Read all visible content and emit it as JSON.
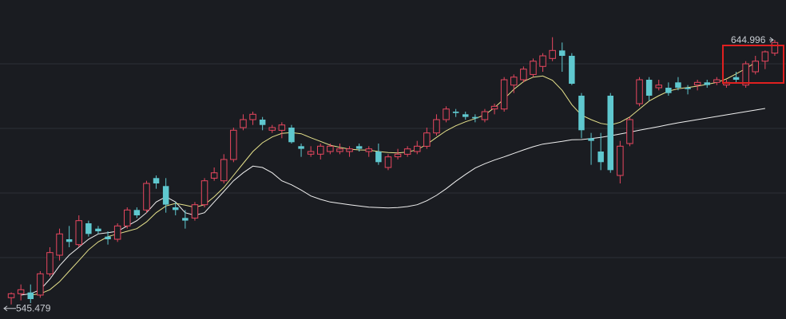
{
  "theme": {
    "background": "#1a1c21",
    "grid": "#2c2f36",
    "up_color": "#e8475f",
    "down_color": "#5fc8cf",
    "highlight_box": "#e02020",
    "label_color": "#c8ccd2"
  },
  "labels": {
    "max_price": "644.996",
    "min_price": "545.479"
  },
  "chart_data": {
    "type": "candlestick",
    "ylim": [
      540,
      660
    ],
    "grid": true,
    "candles": [
      {
        "o": 548,
        "h": 550,
        "l": 545.479,
        "c": 549.5
      },
      {
        "o": 549.5,
        "h": 553,
        "l": 547,
        "c": 551
      },
      {
        "o": 550,
        "h": 553,
        "l": 546,
        "c": 547.5
      },
      {
        "o": 549,
        "h": 558,
        "l": 548,
        "c": 557
      },
      {
        "o": 557,
        "h": 567,
        "l": 556,
        "c": 565
      },
      {
        "o": 564,
        "h": 574,
        "l": 562,
        "c": 572
      },
      {
        "o": 570,
        "h": 575,
        "l": 567,
        "c": 569
      },
      {
        "o": 568,
        "h": 579,
        "l": 567,
        "c": 577
      },
      {
        "o": 576,
        "h": 577,
        "l": 571,
        "c": 572
      },
      {
        "o": 574,
        "h": 575,
        "l": 572,
        "c": 573
      },
      {
        "o": 571,
        "h": 573,
        "l": 568,
        "c": 570
      },
      {
        "o": 570,
        "h": 576,
        "l": 569,
        "c": 575
      },
      {
        "o": 575,
        "h": 582,
        "l": 574,
        "c": 581
      },
      {
        "o": 581,
        "h": 582,
        "l": 578,
        "c": 579
      },
      {
        "o": 581,
        "h": 592,
        "l": 580,
        "c": 591
      },
      {
        "o": 593,
        "h": 594,
        "l": 589,
        "c": 591
      },
      {
        "o": 590,
        "h": 593,
        "l": 580,
        "c": 583
      },
      {
        "o": 582,
        "h": 584,
        "l": 579,
        "c": 581
      },
      {
        "o": 578,
        "h": 581,
        "l": 574,
        "c": 577
      },
      {
        "o": 578,
        "h": 584,
        "l": 577,
        "c": 583
      },
      {
        "o": 583,
        "h": 593,
        "l": 582,
        "c": 592
      },
      {
        "o": 593,
        "h": 597,
        "l": 592,
        "c": 595
      },
      {
        "o": 592,
        "h": 602,
        "l": 591,
        "c": 600
      },
      {
        "o": 600,
        "h": 612,
        "l": 599,
        "c": 611
      },
      {
        "o": 612,
        "h": 617,
        "l": 611,
        "c": 615
      },
      {
        "o": 615,
        "h": 618,
        "l": 613,
        "c": 617
      },
      {
        "o": 615,
        "h": 616,
        "l": 611,
        "c": 613
      },
      {
        "o": 611,
        "h": 613,
        "l": 610,
        "c": 612
      },
      {
        "o": 611,
        "h": 614,
        "l": 608,
        "c": 613
      },
      {
        "o": 612,
        "h": 613,
        "l": 606,
        "c": 606.5
      },
      {
        "o": 605,
        "h": 606,
        "l": 601,
        "c": 604
      },
      {
        "o": 602,
        "h": 605,
        "l": 601,
        "c": 603
      },
      {
        "o": 602,
        "h": 606,
        "l": 600,
        "c": 605
      },
      {
        "o": 603,
        "h": 606,
        "l": 602,
        "c": 605
      },
      {
        "o": 603,
        "h": 606,
        "l": 602,
        "c": 604
      },
      {
        "o": 603,
        "h": 605,
        "l": 601,
        "c": 604
      },
      {
        "o": 605,
        "h": 606,
        "l": 603,
        "c": 604
      },
      {
        "o": 603,
        "h": 605,
        "l": 601,
        "c": 604
      },
      {
        "o": 603,
        "h": 606,
        "l": 598,
        "c": 599
      },
      {
        "o": 597,
        "h": 602,
        "l": 596,
        "c": 601
      },
      {
        "o": 601,
        "h": 604,
        "l": 600,
        "c": 602
      },
      {
        "o": 602,
        "h": 605,
        "l": 601,
        "c": 604
      },
      {
        "o": 603,
        "h": 607,
        "l": 602,
        "c": 605
      },
      {
        "o": 605,
        "h": 612,
        "l": 604,
        "c": 610
      },
      {
        "o": 610,
        "h": 617,
        "l": 609,
        "c": 615
      },
      {
        "o": 615,
        "h": 620,
        "l": 614,
        "c": 619
      },
      {
        "o": 618,
        "h": 619,
        "l": 616,
        "c": 617.5
      },
      {
        "o": 617,
        "h": 618,
        "l": 615,
        "c": 616
      },
      {
        "o": 616,
        "h": 617,
        "l": 614,
        "c": 615.5
      },
      {
        "o": 615,
        "h": 619,
        "l": 614,
        "c": 618
      },
      {
        "o": 619,
        "h": 621,
        "l": 617,
        "c": 620
      },
      {
        "o": 619,
        "h": 631,
        "l": 618,
        "c": 630
      },
      {
        "o": 628,
        "h": 632,
        "l": 625,
        "c": 631
      },
      {
        "o": 630,
        "h": 635,
        "l": 629,
        "c": 634
      },
      {
        "o": 632,
        "h": 638,
        "l": 631,
        "c": 637
      },
      {
        "o": 635,
        "h": 640,
        "l": 633,
        "c": 639
      },
      {
        "o": 638,
        "h": 646,
        "l": 637,
        "c": 641
      },
      {
        "o": 641,
        "h": 644,
        "l": 633,
        "c": 639
      },
      {
        "o": 639,
        "h": 640,
        "l": 628,
        "c": 628.5
      },
      {
        "o": 624,
        "h": 625,
        "l": 608,
        "c": 611
      },
      {
        "o": 608,
        "h": 610,
        "l": 598,
        "c": 607
      },
      {
        "o": 603,
        "h": 610,
        "l": 596,
        "c": 599
      },
      {
        "o": 624,
        "h": 625,
        "l": 595,
        "c": 596
      },
      {
        "o": 594,
        "h": 607,
        "l": 591,
        "c": 605
      },
      {
        "o": 606,
        "h": 616,
        "l": 605,
        "c": 615
      },
      {
        "o": 621,
        "h": 631,
        "l": 620,
        "c": 630
      },
      {
        "o": 630,
        "h": 631,
        "l": 622,
        "c": 624
      },
      {
        "o": 627,
        "h": 630,
        "l": 626,
        "c": 628
      },
      {
        "o": 627,
        "h": 629,
        "l": 624,
        "c": 625
      },
      {
        "o": 629,
        "h": 631,
        "l": 626,
        "c": 627
      },
      {
        "o": 627,
        "h": 628,
        "l": 624.5,
        "c": 626.5
      },
      {
        "o": 628,
        "h": 630,
        "l": 626,
        "c": 629
      },
      {
        "o": 629,
        "h": 630,
        "l": 627,
        "c": 628
      },
      {
        "o": 629,
        "h": 631,
        "l": 628,
        "c": 630
      },
      {
        "o": 628,
        "h": 630,
        "l": 627,
        "c": 629
      },
      {
        "o": 631,
        "h": 633,
        "l": 629,
        "c": 630
      },
      {
        "o": 628,
        "h": 637,
        "l": 627,
        "c": 636
      },
      {
        "o": 633,
        "h": 639,
        "l": 632,
        "c": 637
      },
      {
        "o": 637,
        "h": 641,
        "l": 634,
        "c": 640.5
      },
      {
        "o": 640,
        "h": 644.996,
        "l": 639,
        "c": 644
      }
    ],
    "moving_averages": [
      {
        "color": "#f0f0f0",
        "values": [
          null,
          549,
          549.5,
          551,
          555,
          560,
          564,
          567,
          570,
          572,
          572.5,
          573,
          575,
          577,
          580,
          584,
          586,
          584,
          580,
          579,
          580,
          584,
          588,
          592,
          595,
          597.5,
          597,
          595,
          592,
          590.5,
          588.5,
          586.3,
          585,
          584,
          583.5,
          583,
          582.5,
          582.1,
          581.9,
          581.8,
          581.9,
          582.3,
          583,
          584.5,
          586.5,
          589,
          591.8,
          594.4,
          596.8,
          598.4,
          599.8,
          601,
          602.3,
          603.6,
          604.8,
          605.8,
          606.3,
          606.8,
          607.4,
          607.5,
          607.9,
          608.3,
          608.9,
          609.6,
          610.3,
          611,
          611.7,
          612.4,
          613.1,
          613.8,
          614.4,
          615,
          615.6,
          616.2,
          616.8,
          617.4,
          618,
          618.6,
          619.2
        ]
      },
      {
        "color": "#e6e28c",
        "values": [
          null,
          null,
          549,
          549.5,
          551,
          554,
          558,
          562,
          566,
          569,
          571,
          572,
          573,
          574,
          576.5,
          580,
          582.5,
          583.5,
          582.8,
          582,
          583,
          586,
          589.5,
          594,
          598.5,
          603,
          606.3,
          608.5,
          609.8,
          610.1,
          609.7,
          608.2,
          606.8,
          605.4,
          604.6,
          603.9,
          603.6,
          603.5,
          603,
          602.6,
          602.5,
          602.8,
          603.7,
          605.7,
          608.3,
          610.8,
          612.7,
          614.2,
          615.4,
          616.8,
          619.5,
          622.8,
          626.4,
          629.3,
          631,
          631.4,
          629.8,
          626,
          620.6,
          616.7,
          615,
          613.6,
          613,
          614,
          616,
          619,
          622,
          624,
          625.7,
          626.6,
          627.1,
          627.6,
          628.3,
          629,
          630.3,
          632.2,
          634.2,
          636.5
        ]
      },
      {
        "color": "#c03c7a",
        "values": [
          null,
          null,
          null,
          null,
          null,
          null,
          null,
          null,
          null,
          null,
          null,
          null,
          null,
          null,
          null,
          null,
          null,
          null,
          null,
          null,
          null,
          null,
          null,
          null,
          null,
          null,
          null,
          null,
          null,
          null,
          null,
          null,
          null,
          null,
          null,
          null,
          null,
          null,
          null,
          null,
          null,
          null,
          null,
          null,
          null,
          null,
          null,
          null,
          null,
          null,
          null,
          null,
          null,
          null,
          null,
          null,
          null,
          null,
          null,
          null,
          null,
          null,
          null,
          null,
          null,
          null,
          null,
          null,
          null,
          null,
          null,
          null,
          null,
          null,
          null,
          null,
          null,
          null,
          null
        ]
      },
      {
        "color": "#3c9f3c",
        "values": [
          null,
          null,
          null,
          null,
          null,
          null,
          null,
          null,
          null,
          null,
          null,
          null,
          null,
          null,
          null,
          null,
          null,
          null,
          null,
          null,
          null,
          null,
          null,
          null,
          null,
          null,
          null,
          null,
          null,
          null,
          null,
          null,
          null,
          null,
          null,
          null,
          null,
          null,
          null,
          null,
          null,
          null,
          null,
          null,
          null,
          null,
          null,
          null,
          null,
          null,
          null,
          null,
          null,
          null,
          null,
          null,
          null,
          null,
          null,
          null,
          null,
          null,
          null,
          null,
          null,
          null,
          null,
          null,
          null,
          null,
          null,
          null,
          null,
          null,
          null,
          null,
          null,
          null,
          null
        ]
      },
      {
        "color": "#d4d4d4",
        "values": [
          null,
          null,
          null,
          null,
          null,
          null,
          null,
          null,
          null,
          null,
          null,
          null,
          null,
          null,
          null,
          null,
          null,
          null,
          null,
          null,
          null,
          null,
          null,
          null,
          null,
          null,
          null,
          null,
          null,
          null,
          null,
          null,
          null,
          null,
          null,
          null,
          null,
          null,
          null,
          null,
          null,
          null,
          null,
          null,
          null,
          null,
          null,
          null,
          null,
          null,
          null,
          null,
          null,
          null,
          null,
          null,
          null,
          null,
          null,
          null,
          null,
          null,
          null,
          null,
          null,
          null,
          null,
          null,
          null,
          null,
          null,
          null,
          null,
          null,
          null,
          null,
          null,
          null,
          null
        ]
      }
    ]
  }
}
